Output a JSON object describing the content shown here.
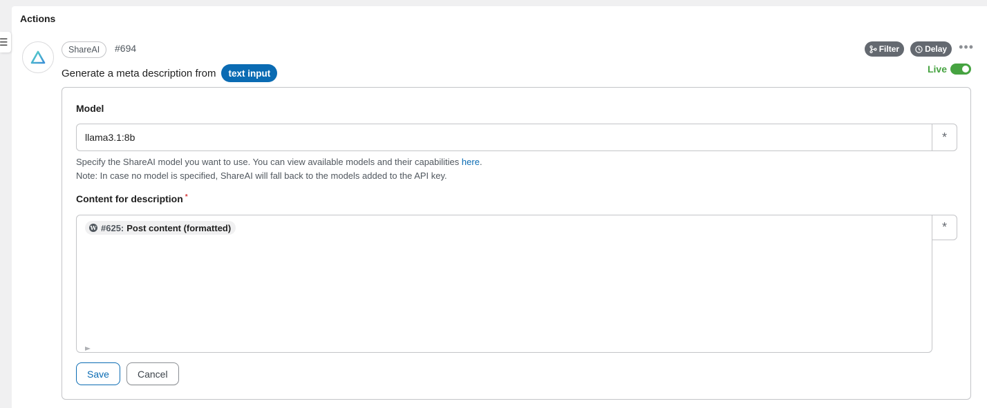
{
  "panel": {
    "title": "Actions"
  },
  "action": {
    "app_name": "ShareAI",
    "id": "#694",
    "title_prefix": "Generate a meta description from",
    "title_token": "text input",
    "filter_label": "Filter",
    "delay_label": "Delay",
    "more_label": "•••",
    "status_label": "Live",
    "status_on": true,
    "colors": {
      "accent": "#0a6bb3",
      "live": "#46a341",
      "chip": "#646970",
      "required": "#d63638"
    }
  },
  "form": {
    "model": {
      "label": "Model",
      "value": "llama3.1:8b",
      "help_line1": "Specify the ShareAI model you want to use. You can view available models and their capabilities",
      "help_link": "here",
      "help_after_link": ".",
      "help_line2": "Note: In case no model is specified, ShareAI will fall back to the models added to the API key."
    },
    "content": {
      "label": "Content for description",
      "required_mark": "*",
      "tag_id": "#625:",
      "tag_label": "Post content (formatted)",
      "tag_icon": "W"
    },
    "variable_button": "*",
    "save_label": "Save",
    "cancel_label": "Cancel"
  }
}
